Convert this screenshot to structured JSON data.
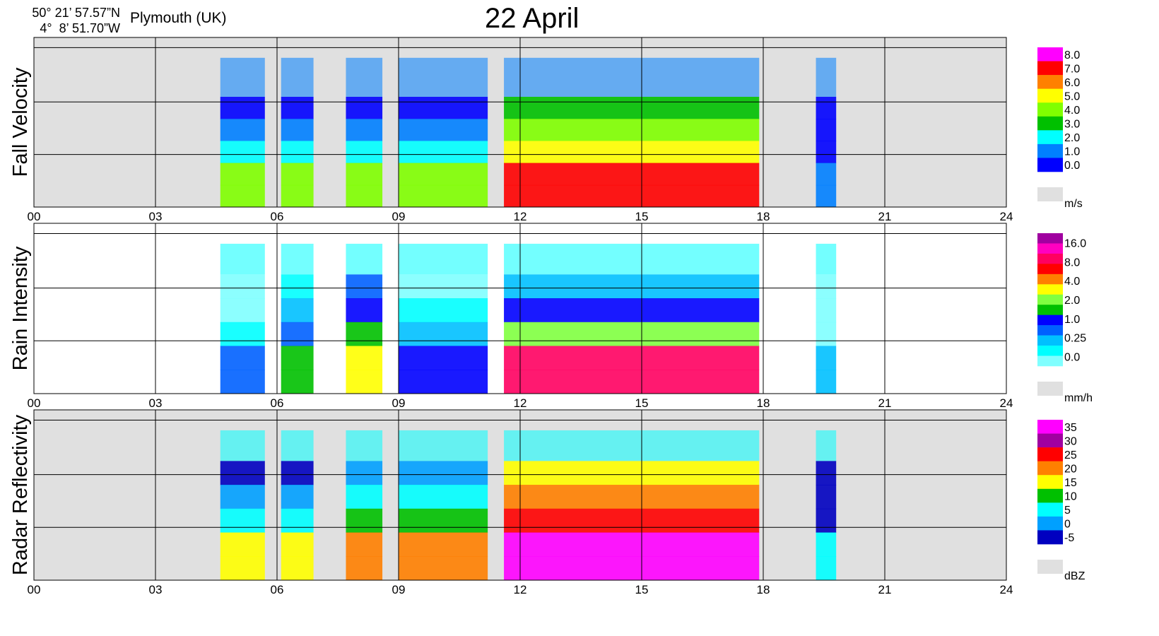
{
  "header": {
    "lat": "50° 21’ 57.57”N",
    "lon": "4°  8’ 51.70”W",
    "place": "Plymouth (UK)",
    "title": "22 April"
  },
  "chart_data": [
    {
      "type": "heatmap",
      "ylabel": "Fall Velocity",
      "x_ticks": [
        "00",
        "03",
        "06",
        "09",
        "12",
        "15",
        "18",
        "21",
        "24"
      ],
      "xlim": [
        0,
        24
      ],
      "legend": {
        "labels": [
          "8.0",
          "7.0",
          "6.0",
          "5.0",
          "4.0",
          "3.0",
          "2.0",
          "1.0",
          "0.0"
        ],
        "unit": "m/s",
        "colors": [
          "#ff00ff",
          "#ff0000",
          "#ff8000",
          "#ffff00",
          "#80ff00",
          "#00c000",
          "#00ffff",
          "#0080ff",
          "#0000ff"
        ]
      },
      "no_data_color": "#e0e0e0",
      "events": [
        {
          "start": 4.6,
          "end": 5.7,
          "level": 4.5
        },
        {
          "start": 6.1,
          "end": 6.9,
          "level": 4
        },
        {
          "start": 7.7,
          "end": 8.6,
          "level": 4
        },
        {
          "start": 9.0,
          "end": 11.2,
          "level": 4
        },
        {
          "start": 11.6,
          "end": 17.9,
          "level": 7
        },
        {
          "start": 19.3,
          "end": 19.8,
          "level": 1
        }
      ]
    },
    {
      "type": "heatmap",
      "ylabel": "Rain Intensity",
      "x_ticks": [
        "00",
        "03",
        "06",
        "09",
        "12",
        "15",
        "18",
        "21",
        "24"
      ],
      "xlim": [
        0,
        24
      ],
      "legend": {
        "labels": [
          "16.0",
          "8.0",
          "4.0",
          "2.0",
          "1.0",
          "0.25",
          "0.0"
        ],
        "unit": "mm/h",
        "colors": [
          "#a000a0",
          "#ff00c0",
          "#ff0060",
          "#ff0000",
          "#ff8000",
          "#ffff00",
          "#80ff40",
          "#00c000",
          "#0000ff",
          "#0060ff",
          "#00c0ff",
          "#00ffff",
          "#80ffff"
        ]
      },
      "no_data_color": "#ffffff",
      "events": [
        {
          "start": 4.6,
          "end": 5.7,
          "level": 0.5
        },
        {
          "start": 6.1,
          "end": 6.9,
          "level": 2
        },
        {
          "start": 7.7,
          "end": 8.6,
          "level": 4
        },
        {
          "start": 9.0,
          "end": 11.2,
          "level": 1
        },
        {
          "start": 11.6,
          "end": 17.9,
          "level": 16
        },
        {
          "start": 19.3,
          "end": 19.8,
          "level": 0.25
        }
      ]
    },
    {
      "type": "heatmap",
      "ylabel": "Radar Reflectivity",
      "x_ticks": [
        "00",
        "03",
        "06",
        "09",
        "12",
        "15",
        "18",
        "21",
        "24"
      ],
      "xlim": [
        0,
        24
      ],
      "legend": {
        "labels": [
          "35",
          "30",
          "25",
          "20",
          "15",
          "10",
          "5",
          "0",
          "-5"
        ],
        "unit": "dBZ",
        "colors": [
          "#ff00ff",
          "#a000a0",
          "#ff0000",
          "#ff8000",
          "#ffff00",
          "#00c000",
          "#00ffff",
          "#00a0ff",
          "#0000c0"
        ]
      },
      "no_data_color": "#e0e0e0",
      "events": [
        {
          "start": 4.6,
          "end": 5.7,
          "level": 15
        },
        {
          "start": 6.1,
          "end": 6.9,
          "level": 15
        },
        {
          "start": 7.7,
          "end": 8.6,
          "level": 20
        },
        {
          "start": 9.0,
          "end": 11.2,
          "level": 20
        },
        {
          "start": 11.6,
          "end": 17.9,
          "level": 35
        },
        {
          "start": 19.3,
          "end": 19.8,
          "level": 5
        }
      ]
    }
  ]
}
